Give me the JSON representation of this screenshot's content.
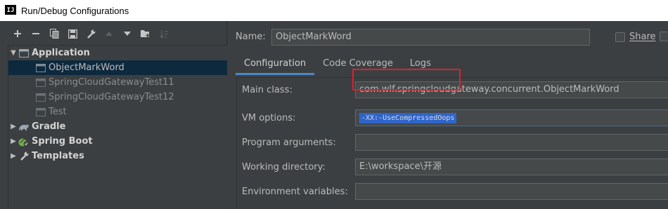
{
  "window": {
    "title": "Run/Debug Configurations",
    "app_icon": "IJ"
  },
  "toolbar": {
    "buttons": [
      {
        "name": "add-icon",
        "glyph": "+"
      },
      {
        "name": "remove-icon",
        "glyph": "−"
      },
      {
        "name": "copy-icon",
        "glyph": "copy"
      },
      {
        "name": "save-icon",
        "glyph": "save"
      },
      {
        "name": "wrench-icon",
        "glyph": "wrench"
      },
      {
        "name": "move-up-icon",
        "glyph": "up"
      },
      {
        "name": "move-down-icon",
        "glyph": "down"
      },
      {
        "name": "new-folder-icon",
        "glyph": "folder"
      },
      {
        "name": "sort-icon",
        "glyph": "sort"
      }
    ]
  },
  "tree": {
    "application": "Application",
    "items": [
      "ObjectMarkWord",
      "SpringCloudGatewayTest11",
      "SpringCloudGatewayTest12",
      "Test"
    ],
    "groups": [
      "Gradle",
      "Spring Boot",
      "Templates"
    ]
  },
  "config": {
    "name_label": "Name:",
    "name_value": "ObjectMarkWord",
    "share_label": "Share",
    "tabs": [
      "Configuration",
      "Code Coverage",
      "Logs"
    ],
    "fields": {
      "main_class_label": "Main class:",
      "main_class_value": "com.wlf.springcloudgateway.concurrent.ObjectMarkWord",
      "vm_options_label": "VM options:",
      "vm_options_value": "-XX:-UseCompressedOops",
      "program_args_label": "Program arguments:",
      "program_args_value": "",
      "working_dir_label": "Working directory:",
      "working_dir_value": "E:\\workspace\\开源",
      "env_vars_label": "Environment variables:",
      "env_vars_value": ""
    }
  },
  "colors": {
    "background": "#3c3f41",
    "selection": "#0d293e",
    "accent": "#4a88c7",
    "annotation": "#e0202a"
  }
}
